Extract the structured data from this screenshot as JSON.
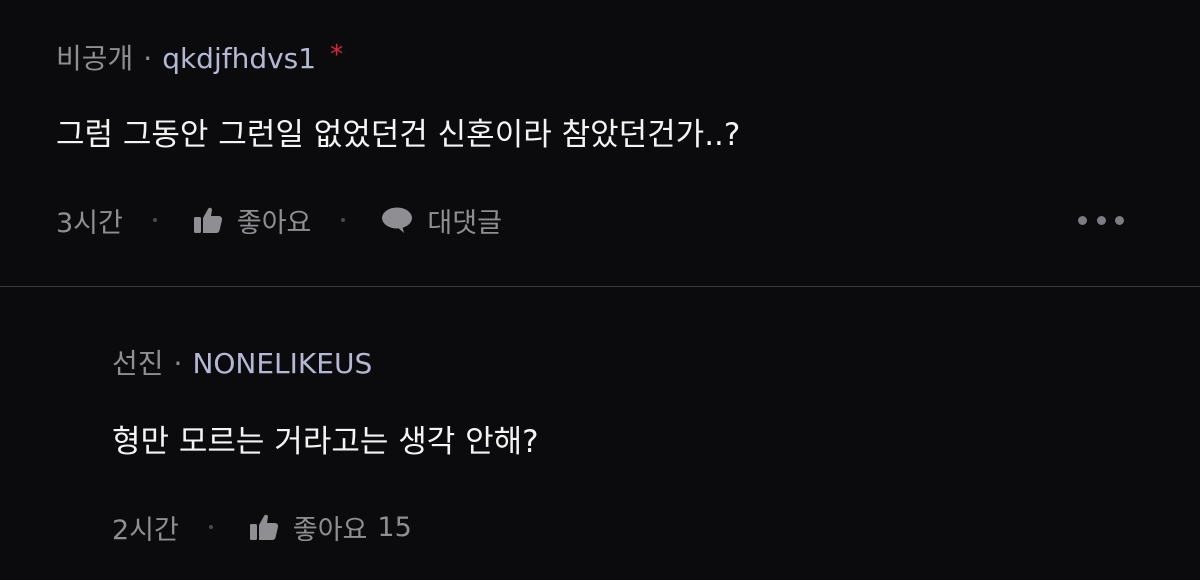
{
  "comments": [
    {
      "author_group": "비공개",
      "separator": "·",
      "author_id": "qkdjfhdvs1",
      "author_badge": "*",
      "content": "그럼 그동안 그런일 없었던건 신혼이라 참았던건가..?",
      "time": "3시간",
      "like_label": "좋아요",
      "reply_label": "대댓글",
      "colors": {
        "id": "#b5b8d4",
        "badge": "#e0233b",
        "meta": "#8e8e93"
      }
    },
    {
      "author_group": "선진",
      "separator": "·",
      "author_id": "NONELIKEUS",
      "content": "형만 모르는 거라고는 생각 안해?",
      "time": "2시간",
      "like_label": "좋아요",
      "like_count": "15"
    }
  ],
  "icons": {
    "like": "thumbs-up-icon",
    "reply": "speech-bubble-icon",
    "more": "more-horizontal-icon"
  },
  "theme": {
    "background": "#0b0b0d",
    "divider": "#3a3a3e"
  }
}
